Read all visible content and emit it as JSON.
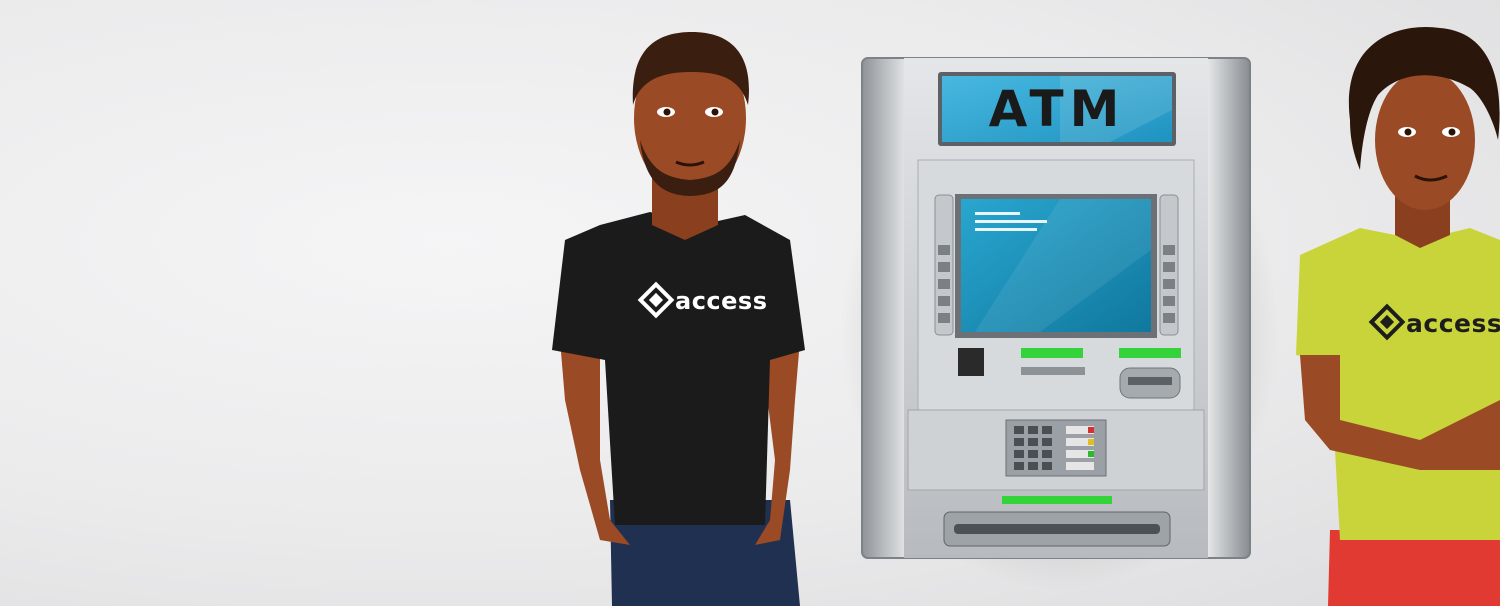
{
  "atm": {
    "sign_text": "ATM",
    "screen_color": "#1b8fb8"
  },
  "people": {
    "left_shirt_brand": "access",
    "right_shirt_brand": "access"
  },
  "colors": {
    "black_shirt": "#1b1b1b",
    "lime_shirt": "#c8d43a",
    "skin": "#9a4a25",
    "green_indicator": "#35d33a"
  }
}
